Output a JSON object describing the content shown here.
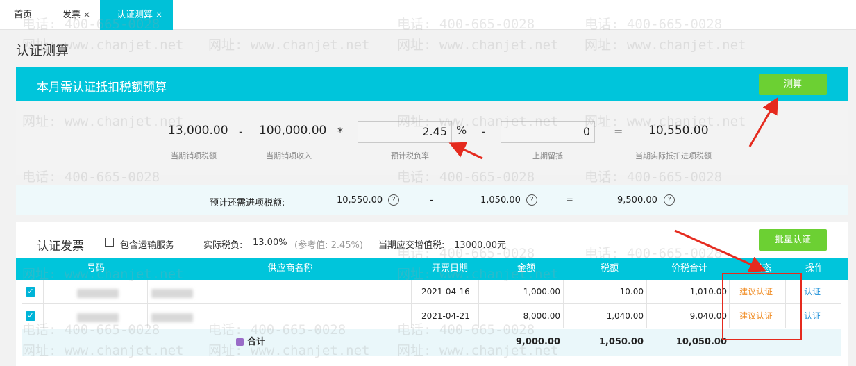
{
  "tabs": [
    {
      "label": "首页",
      "closable": false,
      "active": false
    },
    {
      "label": "发票",
      "closable": true,
      "active": false
    },
    {
      "label": "认证测算",
      "closable": true,
      "active": true
    }
  ],
  "tab_close_glyph": "×",
  "page_title": "认证测算",
  "budget": {
    "title": "本月需认证抵扣税额预算",
    "calc_button": "测算",
    "output_tax": "13,000.00",
    "output_tax_label": "当期销项税额",
    "op_minus": "-",
    "output_income": "100,000.00",
    "output_income_label": "当期销项收入",
    "op_times": "*",
    "tax_rate": "2.45",
    "tax_rate_unit": "%",
    "tax_rate_label": "预计税负率",
    "op_minus_2": "-",
    "prev_retained": "0",
    "prev_retained_label": "上期留抵",
    "op_equals": "=",
    "actual_deduct": "10,550.00",
    "actual_deduct_label": "当期实际抵扣进项税额"
  },
  "estimate": {
    "label": "预计还需进项税额:",
    "value1": "10,550.00",
    "op_minus": "-",
    "value2": "1,050.00",
    "op_equals": "=",
    "result": "9,500.00",
    "help_glyph": "?"
  },
  "invoice_section": {
    "title": "认证发票",
    "include_transport_label": "包含运输服务",
    "include_transport_checked": false,
    "actual_burden_label": "实际税负:",
    "actual_burden_value": "13.00%",
    "reference_text": "(参考值: 2.45%)",
    "vat_due_label": "当期应交增值税:",
    "vat_due_value": "13000.00元",
    "batch_button": "批量认证"
  },
  "table": {
    "columns": [
      "号码",
      "供应商名称",
      "开票日期",
      "金额",
      "税额",
      "价税合计",
      "状态",
      "操作"
    ],
    "rows": [
      {
        "checked": true,
        "number": "",
        "supplier": "",
        "date": "2021-04-16",
        "amount": "1,000.00",
        "tax": "10.00",
        "total": "1,010.00",
        "status": "建议认证",
        "action": "认证"
      },
      {
        "checked": true,
        "number": "",
        "supplier": "",
        "date": "2021-04-21",
        "amount": "8,000.00",
        "tax": "1,040.00",
        "total": "9,040.00",
        "status": "建议认证",
        "action": "认证"
      }
    ],
    "total_row": {
      "label": "合计",
      "amount": "9,000.00",
      "tax": "1,050.00",
      "total": "10,050.00"
    },
    "checkmark_glyph": "✓"
  },
  "watermark": {
    "phone": "电话: 400-665-0028",
    "site": "网址: www.chanjet.net"
  },
  "colors": {
    "accent": "#00c5db",
    "button_green": "#6cd033",
    "status_orange": "#f08a1f",
    "link_blue": "#1a8fd8",
    "annotation_red": "#e52a1e"
  }
}
